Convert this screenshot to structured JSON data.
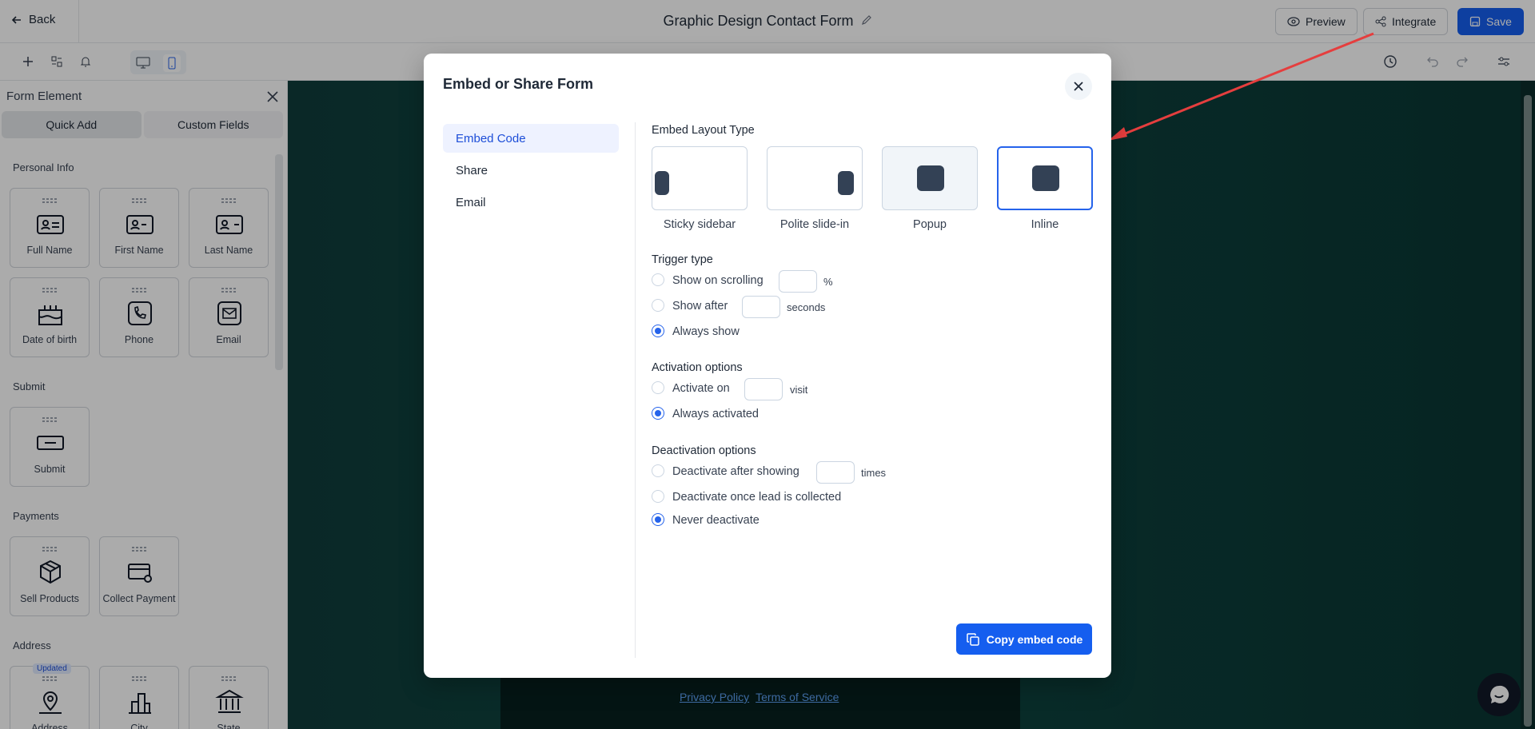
{
  "topbar": {
    "back_label": "Back",
    "title": "Graphic Design Contact Form",
    "preview_label": "Preview",
    "integrate_label": "Integrate",
    "save_label": "Save"
  },
  "sidebar": {
    "header": "Form Element",
    "tabs": [
      "Quick Add",
      "Custom Fields"
    ],
    "sections": {
      "personal": "Personal Info",
      "submit": "Submit",
      "payments": "Payments",
      "address": "Address"
    },
    "personal_items": [
      "Full Name",
      "First Name",
      "Last Name",
      "Date of birth",
      "Phone",
      "Email"
    ],
    "submit_items": [
      "Submit"
    ],
    "payment_items": [
      "Sell Products",
      "Collect Payment"
    ],
    "address_items": [
      "Address",
      "City",
      "State"
    ],
    "address_badge": "Updated"
  },
  "canvas": {
    "links": [
      "Privacy Policy",
      "Terms of Service"
    ]
  },
  "modal": {
    "title": "Embed or Share Form",
    "nav": [
      "Embed Code",
      "Share",
      "Email"
    ],
    "layout_heading": "Embed Layout Type",
    "layouts": [
      "Sticky sidebar",
      "Polite slide-in",
      "Popup",
      "Inline"
    ],
    "selected_layout": "Inline",
    "trigger_heading": "Trigger type",
    "trigger_options": [
      "Show on scrolling",
      "Show after",
      "Always show"
    ],
    "trigger_suffixes": [
      "%",
      "seconds"
    ],
    "activation_heading": "Activation options",
    "activation_options": [
      "Activate on",
      "Always activated"
    ],
    "activation_suffix": "visit",
    "deactivation_heading": "Deactivation options",
    "deactivation_options": [
      "Deactivate after showing",
      "Deactivate once lead is collected",
      "Never deactivate"
    ],
    "deactivation_suffix": "times",
    "copy_label": "Copy embed code"
  },
  "colors": {
    "accent": "#155eef",
    "canvas_bg": "#0d4541",
    "annotation_arrow": "#e53e3e"
  }
}
